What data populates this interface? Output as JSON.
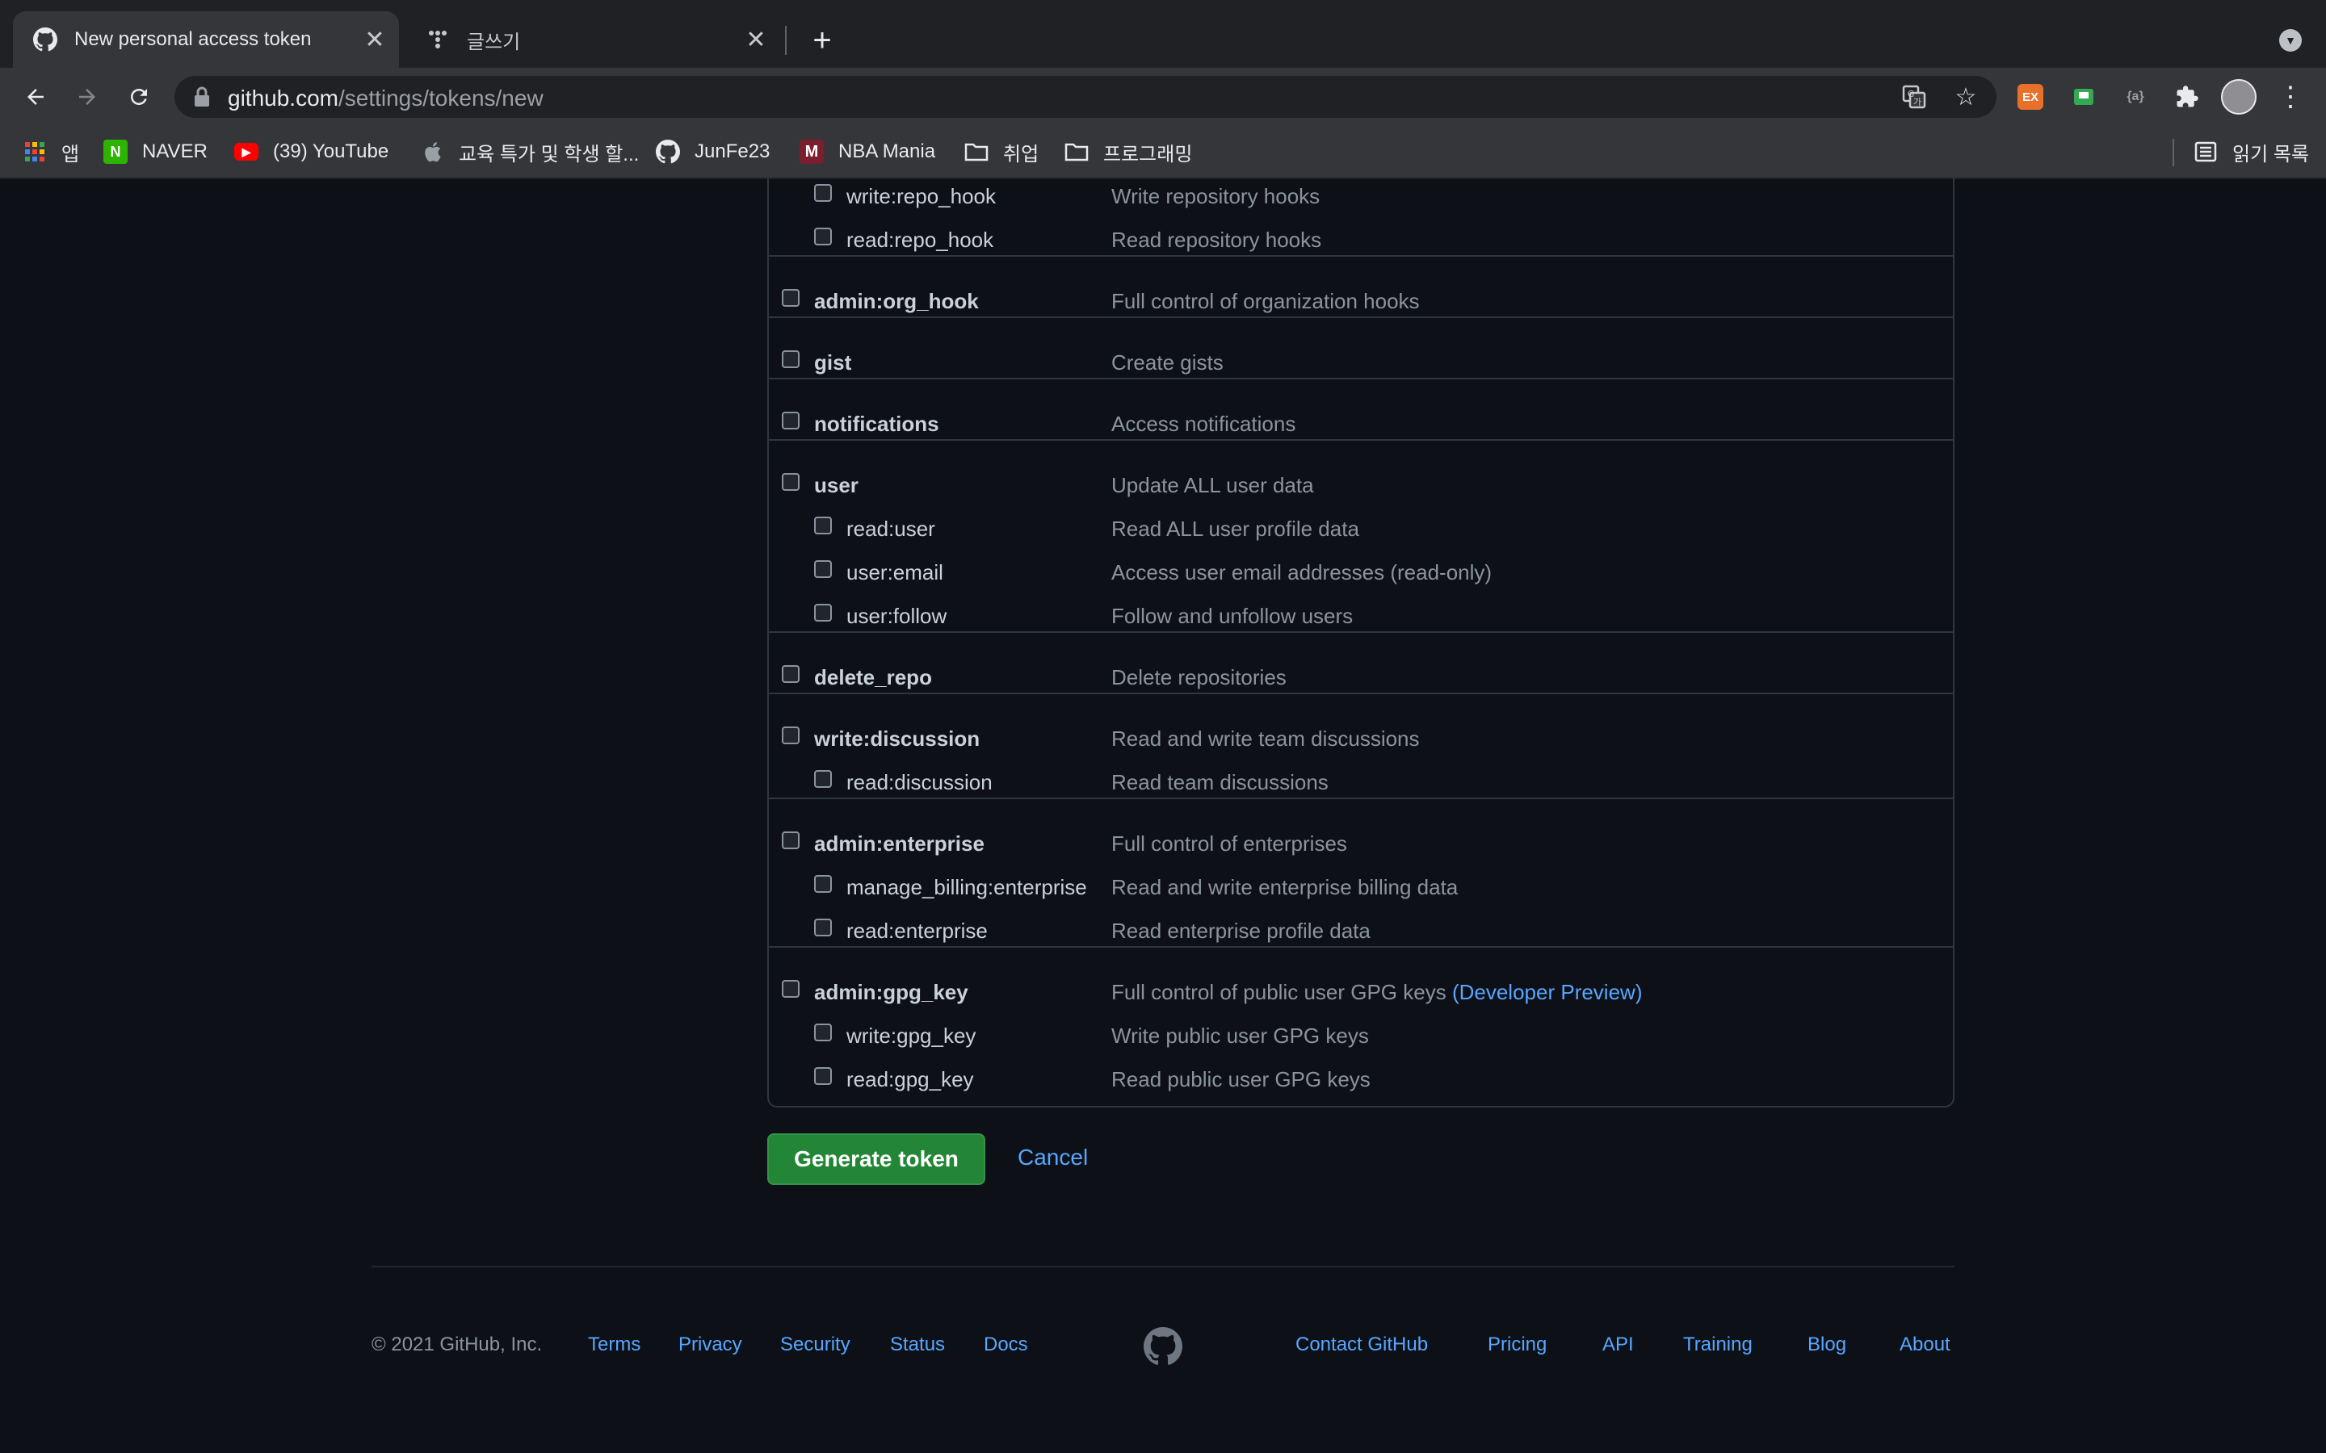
{
  "browser": {
    "tabs": [
      {
        "title": "New personal access token",
        "active": true
      },
      {
        "title": "글쓰기",
        "active": false
      }
    ],
    "url_domain": "github.com",
    "url_path": "/settings/tokens/new",
    "bookmarks": [
      {
        "label": "앱",
        "icon": "apps-grid-icon"
      },
      {
        "label": "NAVER",
        "icon": "naver-icon"
      },
      {
        "label": "(39) YouTube",
        "icon": "youtube-icon"
      },
      {
        "label": "교육 특가 및 학생 할...",
        "icon": "apple-icon"
      },
      {
        "label": "JunFe23",
        "icon": "github-icon"
      },
      {
        "label": "NBA Mania",
        "icon": "nba-mania-icon"
      },
      {
        "label": "취업",
        "icon": "folder-icon"
      },
      {
        "label": "프로그래밍",
        "icon": "folder-icon"
      }
    ],
    "reading_list": "읽기 목록",
    "extensions": [
      "EX"
    ]
  },
  "scopes": [
    {
      "name": "write:repo_hook",
      "desc": "Write repository hooks",
      "level": "child"
    },
    {
      "name": "read:repo_hook",
      "desc": "Read repository hooks",
      "level": "child"
    },
    {
      "name": "admin:org_hook",
      "desc": "Full control of organization hooks",
      "level": "parent"
    },
    {
      "name": "gist",
      "desc": "Create gists",
      "level": "parent"
    },
    {
      "name": "notifications",
      "desc": "Access notifications",
      "level": "parent"
    },
    {
      "name": "user",
      "desc": "Update ALL user data",
      "level": "parent"
    },
    {
      "name": "read:user",
      "desc": "Read ALL user profile data",
      "level": "child"
    },
    {
      "name": "user:email",
      "desc": "Access user email addresses (read-only)",
      "level": "child"
    },
    {
      "name": "user:follow",
      "desc": "Follow and unfollow users",
      "level": "child"
    },
    {
      "name": "delete_repo",
      "desc": "Delete repositories",
      "level": "parent"
    },
    {
      "name": "write:discussion",
      "desc": "Read and write team discussions",
      "level": "parent"
    },
    {
      "name": "read:discussion",
      "desc": "Read team discussions",
      "level": "child"
    },
    {
      "name": "admin:enterprise",
      "desc": "Full control of enterprises",
      "level": "parent"
    },
    {
      "name": "manage_billing:enterprise",
      "desc": "Read and write enterprise billing data",
      "level": "child"
    },
    {
      "name": "read:enterprise",
      "desc": "Read enterprise profile data",
      "level": "child"
    },
    {
      "name": "admin:gpg_key",
      "desc": "Full control of public user GPG keys",
      "link": "(Developer Preview)",
      "level": "parent"
    },
    {
      "name": "write:gpg_key",
      "desc": "Write public user GPG keys",
      "level": "child"
    },
    {
      "name": "read:gpg_key",
      "desc": "Read public user GPG keys",
      "level": "child"
    }
  ],
  "actions": {
    "generate": "Generate token",
    "cancel": "Cancel"
  },
  "footer": {
    "copyright": "© 2021 GitHub, Inc.",
    "left_links": [
      "Terms",
      "Privacy",
      "Security",
      "Status",
      "Docs"
    ],
    "right_links": [
      "Contact GitHub",
      "Pricing",
      "API",
      "Training",
      "Blog",
      "About"
    ]
  },
  "colors": {
    "background": "#0d1117",
    "border": "#30363d",
    "text": "#c9d1d9",
    "muted": "#8b949e",
    "link": "#58a6ff",
    "primary_button": "#238636"
  }
}
